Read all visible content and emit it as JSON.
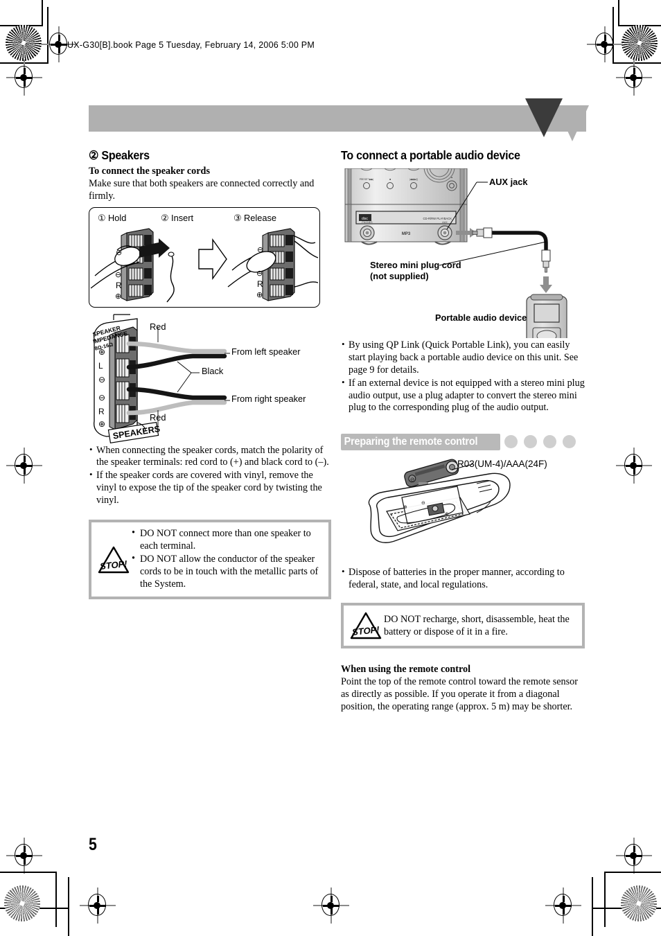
{
  "running_header": "UX-G30[B].book  Page 5  Tuesday, February 14, 2006  5:00 PM",
  "page_number": "5",
  "colors": {
    "banner": "#b0b0b0",
    "banner_arrow": "#3b3b3b",
    "section_bar": "#b9b9b9",
    "section_dots": "#cfcfcf",
    "caution_border": "#b3b3b3"
  },
  "left_column": {
    "heading": "② Speakers",
    "subheading": "To connect the speaker cords",
    "intro": "Make sure that both speakers are connected correctly and firmly.",
    "step_figure": {
      "steps": [
        "① Hold",
        "② Insert",
        "③ Release"
      ],
      "terminal_marks": [
        "⊖",
        "R",
        "⊕"
      ]
    },
    "terminal_figure": {
      "panel_text_line1": "SPEAKER",
      "panel_text_line2": "IMPEDANCE",
      "panel_text_line3": "8Ω-16Ω",
      "terminal_marks": [
        "⊕",
        "L",
        "⊖",
        "⊖",
        "R",
        "⊕"
      ],
      "speakers_badge": "SPEAKERS",
      "label_red_top": "Red",
      "label_red_bottom": "Red",
      "label_black": "Black",
      "label_left_speaker": "From left speaker",
      "label_right_speaker": "From right speaker"
    },
    "bullets": [
      "When connecting the speaker cords, match the polarity of the speaker terminals: red cord to (+) and black cord to (–).",
      "If the speaker cords are covered with vinyl, remove the vinyl to expose the tip of the speaker cord by twisting the vinyl."
    ],
    "caution": {
      "icon": "stop-icon",
      "icon_text": "STOP!",
      "bullets": [
        "DO NOT connect more than one speaker to each terminal.",
        "DO NOT allow the conductor of the speaker cords to be in touch with the metallic parts of the System."
      ]
    }
  },
  "right_column": {
    "heading": "To connect a portable audio device",
    "figure": {
      "aux_jack_label": "AUX jack",
      "cord_label_line1": "Stereo mini plug cord",
      "cord_label_line2": "(not supplied)",
      "device_label": "Portable audio device",
      "unit_panel_text": "COMPACT DISC DIGITAL AUDIO",
      "unit_playback_text": "CD-R/RW PLAYBACK",
      "unit_mp3_text": "MP3"
    },
    "bullets": [
      "By using QP Link (Quick Portable Link), you can easily start playing back a portable audio device on this unit. See page 9 for details.",
      "If an external device is not equipped with a stereo mini plug audio output, use a plug adapter to convert the stereo mini plug to the corresponding plug of the audio output."
    ],
    "section": {
      "title": "Preparing the remote control",
      "dot_count": 4,
      "battery_label": "R03(UM-4)/AAA(24F)",
      "bullets": [
        "Dispose of batteries in the proper manner, according to federal, state, and local regulations."
      ],
      "caution": {
        "icon": "stop-icon",
        "icon_text": "STOP!",
        "text": "DO NOT recharge, short, disassemble, heat the battery or dispose of it in a fire."
      },
      "usage_heading": "When using the remote control",
      "usage_text": "Point the top of the remote control toward the remote sensor as directly as possible. If you operate it from a diagonal position, the operating range (approx. 5 m) may be shorter."
    }
  }
}
